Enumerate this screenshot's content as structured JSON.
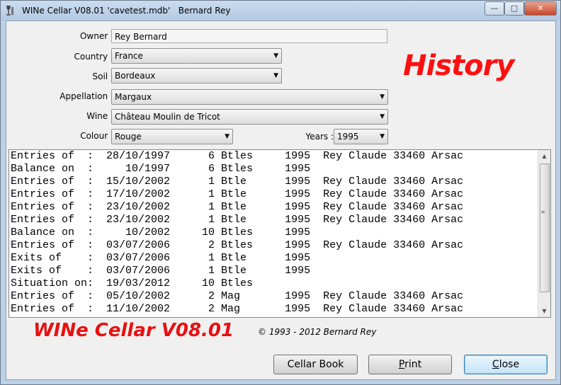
{
  "window": {
    "title": "WINe Cellar V08.01 'cavetest.mdb'   Bernard Rey",
    "minimize_glyph": "—",
    "maximize_glyph": "□",
    "close_glyph": "✕"
  },
  "form": {
    "owner": {
      "label": "Owner :",
      "value": "Rey Bernard"
    },
    "country": {
      "label": "Country :",
      "value": "France"
    },
    "soil": {
      "label": "Soil :",
      "value": "Bordeaux"
    },
    "appellation": {
      "label": "Appellation :",
      "value": "Margaux"
    },
    "wine": {
      "label": "Wine :",
      "value": "Château Moulin de Tricot"
    },
    "colour": {
      "label": "Colour :",
      "value": "Rouge"
    },
    "years": {
      "label": "Years :",
      "value": "1995"
    }
  },
  "heading": "History",
  "history_rows": [
    "Entries of  :  28/10/1997      6 Btles     1995  Rey Claude 33460 Arsac",
    "Balance on  :     10/1997      6 Btles     1995",
    "Entries of  :  15/10/2002      1 Btle      1995  Rey Claude 33460 Arsac",
    "Entries of  :  17/10/2002      1 Btle      1995  Rey Claude 33460 Arsac",
    "Entries of  :  23/10/2002      1 Btle      1995  Rey Claude 33460 Arsac",
    "Entries of  :  23/10/2002      1 Btle      1995  Rey Claude 33460 Arsac",
    "Balance on  :     10/2002     10 Btles     1995",
    "Entries of  :  03/07/2006      2 Btles     1995  Rey Claude 33460 Arsac",
    "Exits of    :  03/07/2006      1 Btle      1995",
    "Exits of    :  03/07/2006      1 Btle      1995",
    "Situation on:  19/03/2012     10 Btles",
    "Entries of  :  05/10/2002      2 Mag       1995  Rey Claude 33460 Arsac",
    "Entries of  :  11/10/2002      2 Mag       1995  Rey Claude 33460 Arsac"
  ],
  "scroll_position": 0.0,
  "brand": "WINe Cellar V08.01",
  "copyright": "© 1993 - 2012 Bernard Rey",
  "buttons": {
    "cellar_book": "Cellar Book",
    "print_first": "P",
    "print_rest": "rint",
    "close_first": "C",
    "close_rest": "lose"
  },
  "colors": {
    "accent_red": "#ff1010",
    "default_button": "#3c7fb1"
  }
}
